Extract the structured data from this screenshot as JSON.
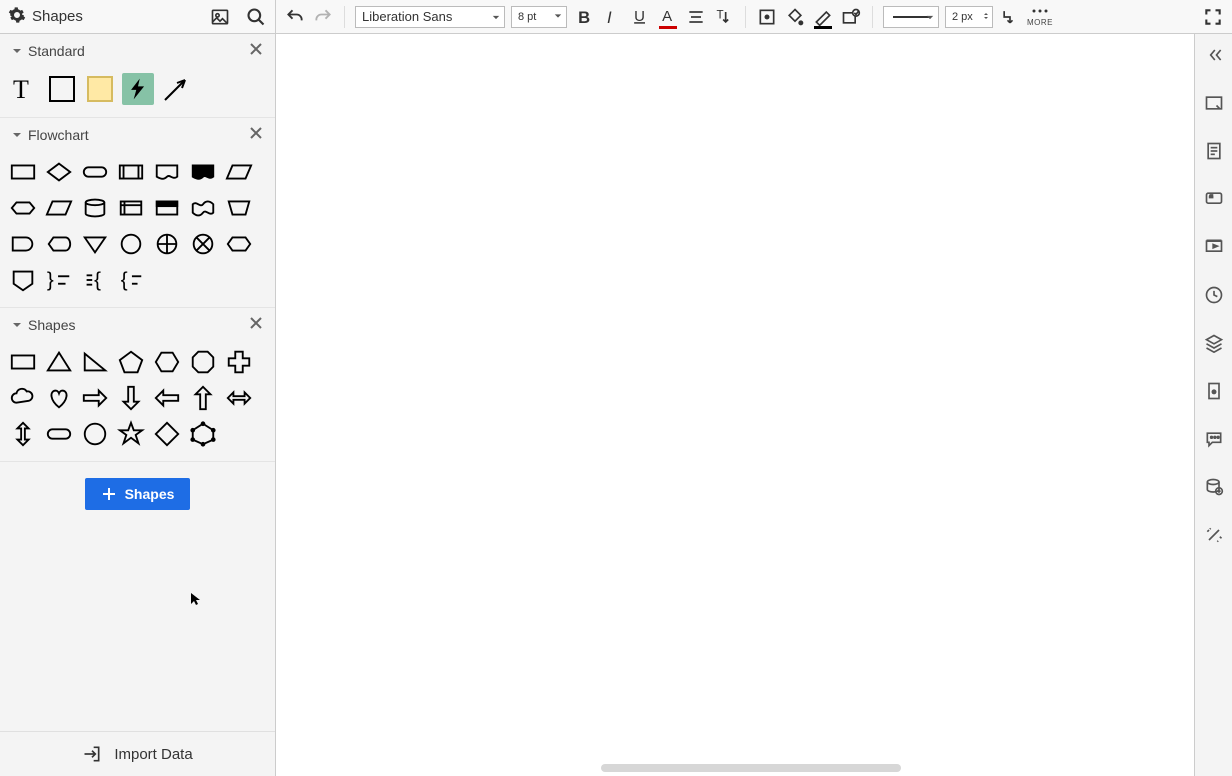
{
  "header": {
    "title": "Shapes",
    "font_family": "Liberation Sans",
    "font_size": "8 pt",
    "line_width": "2 px",
    "more_label": "MORE"
  },
  "sidebar": {
    "panels": {
      "standard": {
        "label": "Standard"
      },
      "flowchart": {
        "label": "Flowchart"
      },
      "shapes": {
        "label": "Shapes"
      }
    },
    "add_shapes_label": "Shapes",
    "import_data_label": "Import Data"
  }
}
